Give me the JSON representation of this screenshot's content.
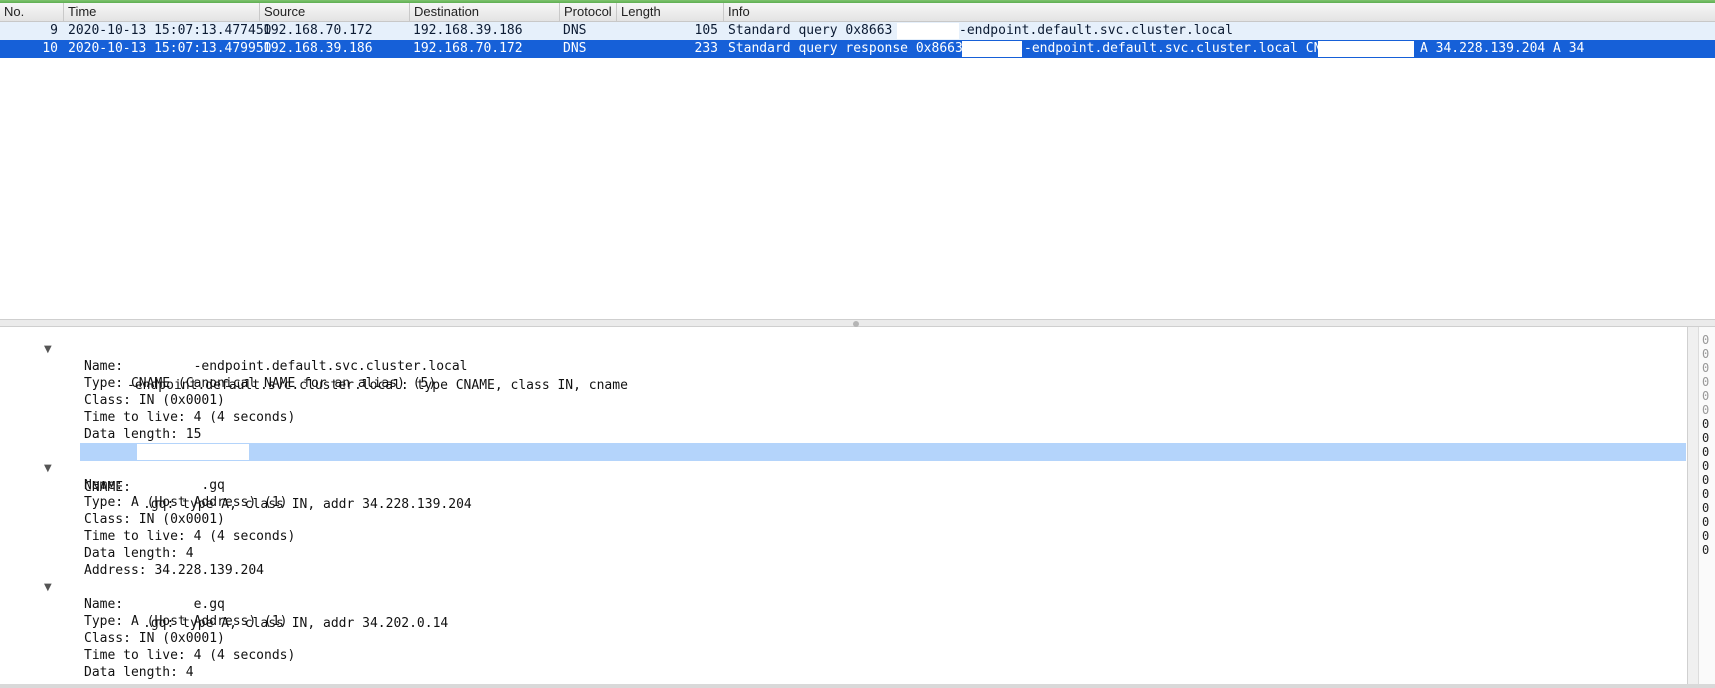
{
  "columns": [
    "No.",
    "Time",
    "Source",
    "Destination",
    "Protocol",
    "Length",
    "Info"
  ],
  "packets": [
    {
      "no": "9",
      "time": "2020-10-13 15:07:13.477450",
      "source": "192.168.70.172",
      "destination": "192.168.39.186",
      "protocol": "DNS",
      "length": "105",
      "info_a": "Standard query 0x8663 A",
      "info_b": "-endpoint.default.svc.cluster.local"
    },
    {
      "no": "10",
      "time": "2020-10-13 15:07:13.479950",
      "source": "192.168.39.186",
      "destination": "192.168.70.172",
      "protocol": "DNS",
      "length": "233",
      "info_a": "Standard query response 0x8663 A",
      "info_b": "-endpoint.default.svc.cluster.local CNAME",
      "info_c": "A 34.228.139.204 A 34"
    }
  ],
  "details": {
    "answer1": {
      "header": "-endpoint.default.svc.cluster.local: type CNAME, class IN, cname",
      "name": "Name:         -endpoint.default.svc.cluster.local",
      "type": "Type: CNAME (Canonical NAME for an alias) (5)",
      "class": "Class: IN (0x0001)",
      "ttl": "Time to live: 4 (4 seconds)",
      "data_length": "Data length: 15",
      "cname": "CNAME:"
    },
    "answer2": {
      "header": ".gq: type A, class IN, addr 34.228.139.204",
      "name": "Name:          .gq",
      "type": "Type: A (Host Address) (1)",
      "class": "Class: IN (0x0001)",
      "ttl": "Time to live: 4 (4 seconds)",
      "data_length": "Data length: 4",
      "address": "Address: 34.228.139.204"
    },
    "answer3": {
      "header": ".gq: type A, class IN, addr 34.202.0.14",
      "name": "Name:         e.gq",
      "type": "Type: A (Host Address) (1)",
      "class": "Class: IN (0x0001)",
      "ttl": "Time to live: 4 (4 seconds)",
      "data_length": "Data length: 4"
    }
  },
  "bytes_column": [
    "0",
    "0",
    "0",
    "0",
    "0",
    "0",
    "0",
    "0",
    "0",
    "0",
    "0",
    "0",
    "0",
    "0",
    "0",
    "0"
  ],
  "colors": {
    "selected_row": "#1660d8",
    "related_row": "#e6f0fb",
    "field_highlight": "#b4d4fb"
  },
  "icons": {
    "row9": "request-arrow-icon",
    "row10": "response-arrow-icon",
    "expander": "expand-triangle-icon"
  }
}
